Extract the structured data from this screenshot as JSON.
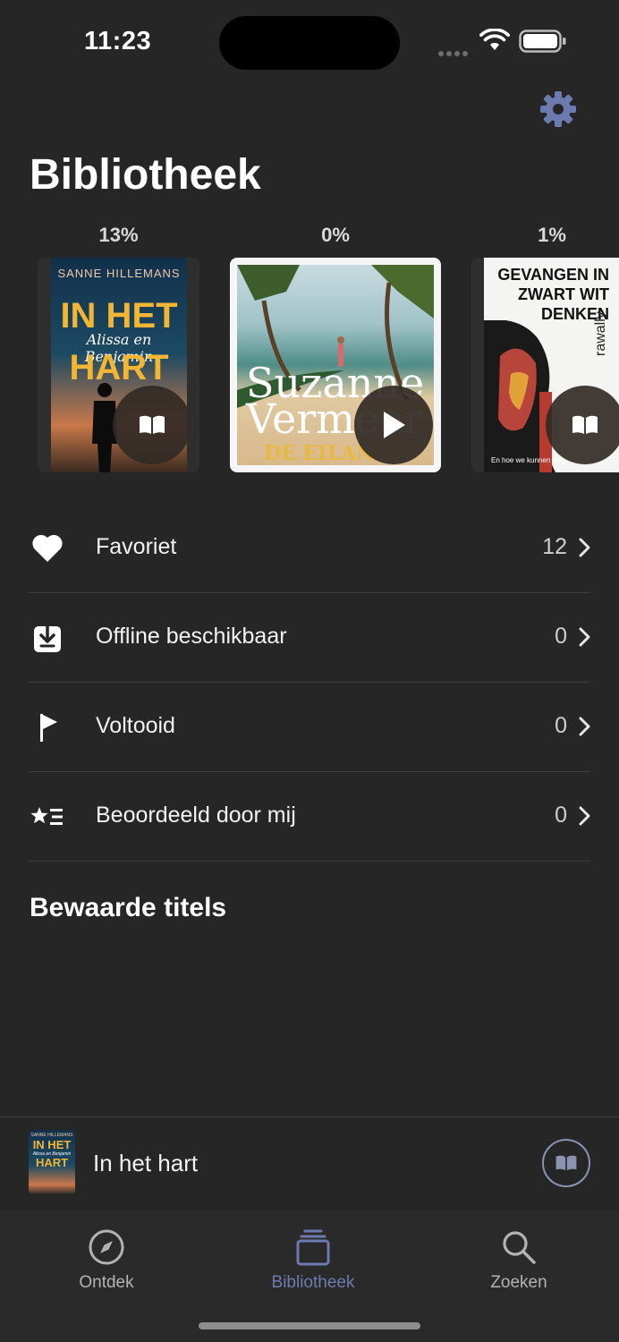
{
  "status_bar": {
    "time": "11:23"
  },
  "header": {
    "title": "Bibliotheek"
  },
  "books": [
    {
      "progress": "13%",
      "author": "SANNE HILLEMANS",
      "title_line1": "IN HET",
      "title_script": "Alissa en Benjamin",
      "title_line2": "HART",
      "action_icon": "book-icon"
    },
    {
      "progress": "0%",
      "title_script": "Suzanne Vermeer",
      "subtitle": "DE EILAND",
      "action_icon": "play-icon"
    },
    {
      "progress": "1%",
      "title": "GEVANGEN IN ZWART WIT DENKEN",
      "author": "rawally",
      "tagline": "En hoe we kunnen ontsnappen",
      "action_icon": "book-icon"
    }
  ],
  "list": [
    {
      "label": "Favoriet",
      "count": "12",
      "icon": "heart-icon"
    },
    {
      "label": "Offline beschikbaar",
      "count": "0",
      "icon": "download-icon"
    },
    {
      "label": "Voltooid",
      "count": "0",
      "icon": "flag-icon"
    },
    {
      "label": "Beoordeeld door mij",
      "count": "0",
      "icon": "star-list-icon"
    }
  ],
  "saved_section": {
    "title": "Bewaarde titels"
  },
  "mini_player": {
    "title": "In het hart",
    "cover_author": "SANNE HILLEMANS",
    "cover_title_line1": "IN HET",
    "cover_title_line2": "HART",
    "cover_script": "Alissa en Benjamin"
  },
  "tabs": [
    {
      "label": "Ontdek",
      "icon": "compass-icon",
      "active": false
    },
    {
      "label": "Bibliotheek",
      "icon": "library-icon",
      "active": true
    },
    {
      "label": "Zoeken",
      "icon": "search-icon",
      "active": false
    }
  ],
  "colors": {
    "background": "#262626",
    "accent": "#6b7bb0",
    "tab_inactive": "#b3b3b3",
    "divider": "#3d3d3d"
  }
}
